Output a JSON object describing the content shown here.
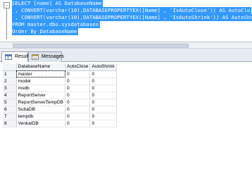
{
  "editor": {
    "collapse_symbol": "-",
    "selection_color": "#3399ff",
    "lines": [
      "SELECT [name] AS DatabaseName",
      " , CONVERT(varchar(10),DATABASEPROPERTYEX([Name] , 'IsAutoClose')) AS AutoClo",
      " , CONVERT(varchar(10),DATABASEPROPERTYEX([Name] , 'IsAutoShrink')) AS AutoShri",
      "FROM master.dbo.sysdatabases",
      "Order By DatabaseName"
    ]
  },
  "tabs": [
    {
      "label": "Results",
      "icon": "grid-icon"
    },
    {
      "label": "Messages",
      "icon": "messages-icon"
    }
  ],
  "results": {
    "columns": [
      "DatabaseName",
      "AutoClose",
      "AutoShrink"
    ],
    "rows": [
      {
        "num": "1",
        "cells": [
          "master",
          "0",
          "0"
        ]
      },
      {
        "num": "2",
        "cells": [
          "model",
          "0",
          "0"
        ]
      },
      {
        "num": "3",
        "cells": [
          "msdb",
          "0",
          "0"
        ]
      },
      {
        "num": "4",
        "cells": [
          "ReportServer",
          "0",
          "0"
        ]
      },
      {
        "num": "5",
        "cells": [
          "ReportServerTempDB",
          "0",
          "0"
        ]
      },
      {
        "num": "6",
        "cells": [
          "SubaDB",
          "0",
          "0"
        ]
      },
      {
        "num": "7",
        "cells": [
          "tempdb",
          "0",
          "0"
        ]
      },
      {
        "num": "8",
        "cells": [
          "VenkatDB",
          "0",
          "0"
        ]
      }
    ]
  }
}
